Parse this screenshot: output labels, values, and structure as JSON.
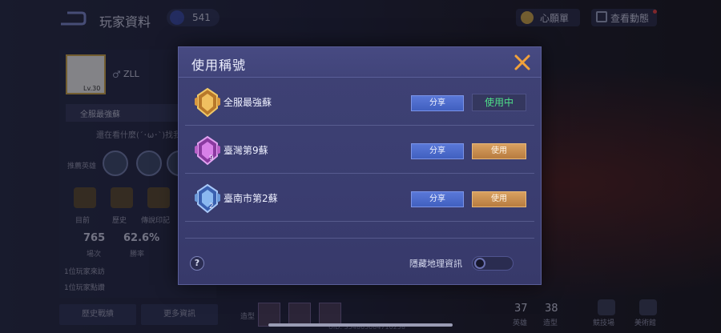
{
  "background": {
    "page_title": "玩家資料",
    "coins": "541",
    "wishlist_label": "心願單",
    "view_dynamics_label": "查看動態",
    "player": {
      "level": "Lv.30",
      "name": "ZLL",
      "current_title": "全服最強蘇",
      "status": "還在看什麼(´･ω･`)找我"
    },
    "section_recommended_heroes": "推薦英雄",
    "ranks": [
      {
        "label": "目前"
      },
      {
        "label": "歷史"
      },
      {
        "label": "傳說印記"
      }
    ],
    "stats": [
      {
        "value": "765",
        "label": "場次"
      },
      {
        "value": "62.6%",
        "label": "勝率"
      }
    ],
    "side_links": [
      "1位玩家來訪",
      "1位玩家點讚"
    ],
    "bottom_buttons": [
      "歷史戰績",
      "更多資訊"
    ],
    "skins_label": "造型",
    "uid": "UID: 354865084710258",
    "counts": [
      {
        "value": "37",
        "label": "英雄"
      },
      {
        "value": "38",
        "label": "造型"
      }
    ],
    "bottom_right": [
      "競技場",
      "美術館"
    ]
  },
  "modal": {
    "title": "使用稱號",
    "rows": [
      {
        "name": "全服最強蘇",
        "share_label": "分享",
        "state_label": "使用中",
        "in_use": true,
        "badge_color": "#d8a040",
        "badge_num": ""
      },
      {
        "name": "臺灣第9蘇",
        "share_label": "分享",
        "state_label": "使用",
        "in_use": false,
        "badge_color": "#c070d0",
        "badge_num": "9"
      },
      {
        "name": "臺南市第2蘇",
        "share_label": "分享",
        "state_label": "使用",
        "in_use": false,
        "badge_color": "#6aa0e8",
        "badge_num": "2"
      }
    ],
    "help_symbol": "?",
    "hide_location_label": "隱藏地理資訊",
    "hide_location_enabled": false
  },
  "colors": {
    "accent_share": "#4a68c8",
    "accent_use": "#c88a4a",
    "in_use_text": "#4fe08a"
  }
}
